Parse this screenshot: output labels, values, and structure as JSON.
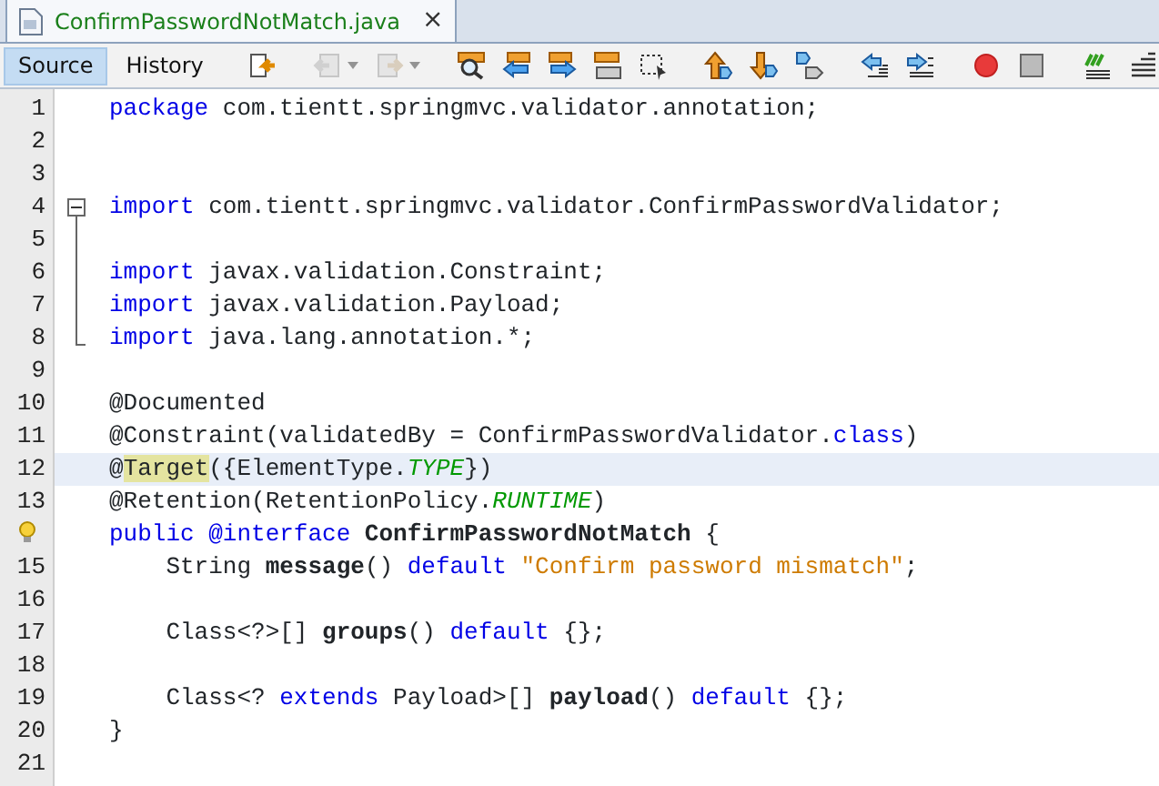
{
  "file_tab": {
    "title": "ConfirmPasswordNotMatch.java",
    "close": "×",
    "selected": true
  },
  "view_tabs": [
    {
      "label": "Source",
      "selected": true
    },
    {
      "label": "History",
      "selected": false
    }
  ],
  "toolbar": [
    {
      "kind": "last-edit",
      "disabled": false
    },
    {
      "kind": "sep"
    },
    {
      "kind": "back",
      "disabled": true,
      "dropdown": true
    },
    {
      "kind": "forward",
      "disabled": true,
      "dropdown": true
    },
    {
      "kind": "sep"
    },
    {
      "kind": "find",
      "disabled": false
    },
    {
      "kind": "find-prev",
      "disabled": false
    },
    {
      "kind": "find-next",
      "disabled": false
    },
    {
      "kind": "highlight",
      "disabled": false
    },
    {
      "kind": "rect-select",
      "disabled": false
    },
    {
      "kind": "sep"
    },
    {
      "kind": "prev-bookmark",
      "disabled": false
    },
    {
      "kind": "next-bookmark",
      "disabled": false
    },
    {
      "kind": "toggle-bookmark",
      "disabled": false
    },
    {
      "kind": "sep"
    },
    {
      "kind": "shift-left",
      "disabled": false
    },
    {
      "kind": "shift-right",
      "disabled": false
    },
    {
      "kind": "sep"
    },
    {
      "kind": "record",
      "disabled": false
    },
    {
      "kind": "stop",
      "disabled": false
    },
    {
      "kind": "sep"
    },
    {
      "kind": "comment",
      "disabled": false
    },
    {
      "kind": "uncomment",
      "disabled": false
    }
  ],
  "lines": [
    {
      "number": "1",
      "selected": false,
      "tokens": [
        {
          "kind": "keyword",
          "text": "package"
        },
        {
          "kind": "plain",
          "text": " com.tientt.springmvc.validator.annotation;"
        }
      ]
    },
    {
      "number": "2",
      "selected": false
    },
    {
      "number": "3",
      "selected": false
    },
    {
      "number": "4",
      "selected": false,
      "expanded": true,
      "tokens": [
        {
          "kind": "keyword",
          "text": "import"
        },
        {
          "kind": "plain",
          "text": " com.tientt.springmvc.validator.ConfirmPasswordValidator;"
        }
      ],
      "children": [
        {
          "number": "5",
          "selected": false
        },
        {
          "number": "6",
          "selected": false,
          "tokens": [
            {
              "kind": "keyword",
              "text": "import"
            },
            {
              "kind": "plain",
              "text": " javax.validation.Constraint;"
            }
          ]
        },
        {
          "number": "7",
          "selected": false,
          "tokens": [
            {
              "kind": "keyword",
              "text": "import"
            },
            {
              "kind": "plain",
              "text": " javax.validation.Payload;"
            }
          ]
        },
        {
          "number": "8",
          "selected": false,
          "tokens": [
            {
              "kind": "keyword",
              "text": "import"
            },
            {
              "kind": "plain",
              "text": " java.lang.annotation.*;"
            }
          ]
        }
      ]
    },
    {
      "number": "9",
      "selected": false
    },
    {
      "number": "10",
      "selected": false,
      "tokens": [
        {
          "kind": "plain",
          "text": "@Documented"
        }
      ]
    },
    {
      "number": "11",
      "selected": false,
      "tokens": [
        {
          "kind": "plain",
          "text": "@Constraint(validatedBy = ConfirmPasswordValidator."
        },
        {
          "kind": "keyword",
          "text": "class"
        },
        {
          "kind": "plain",
          "text": ")"
        }
      ]
    },
    {
      "number": "12",
      "selected": true,
      "tokens": [
        {
          "kind": "plain",
          "text": "@"
        },
        {
          "kind": "marked",
          "text": "Target"
        },
        {
          "kind": "plain",
          "text": "({ElementType."
        },
        {
          "kind": "constant",
          "text": "TYPE"
        },
        {
          "kind": "plain",
          "text": "})"
        }
      ]
    },
    {
      "number": "13",
      "selected": false,
      "tokens": [
        {
          "kind": "plain",
          "text": "@Retention(RetentionPolicy."
        },
        {
          "kind": "constant",
          "text": "RUNTIME"
        },
        {
          "kind": "plain",
          "text": ")"
        }
      ]
    },
    {
      "selected": false,
      "hint": true,
      "tokens": [
        {
          "kind": "keyword",
          "text": "public @interface"
        },
        {
          "kind": "bold",
          "text": " ConfirmPasswordNotMatch"
        },
        {
          "kind": "plain",
          "text": " {"
        }
      ]
    },
    {
      "number": "15",
      "selected": false,
      "tokens": [
        {
          "kind": "plain",
          "text": "    String "
        },
        {
          "kind": "bold",
          "text": "message"
        },
        {
          "kind": "plain",
          "text": "() "
        },
        {
          "kind": "keyword",
          "text": "default"
        },
        {
          "kind": "string",
          "text": " \"Confirm password mismatch\""
        },
        {
          "kind": "plain",
          "text": ";"
        }
      ]
    },
    {
      "number": "16",
      "selected": false
    },
    {
      "number": "17",
      "selected": false,
      "tokens": [
        {
          "kind": "plain",
          "text": "    Class<?>[] "
        },
        {
          "kind": "bold",
          "text": "groups"
        },
        {
          "kind": "plain",
          "text": "() "
        },
        {
          "kind": "keyword",
          "text": "default"
        },
        {
          "kind": "plain",
          "text": " {};"
        }
      ]
    },
    {
      "number": "18",
      "selected": false
    },
    {
      "number": "19",
      "selected": false,
      "tokens": [
        {
          "kind": "plain",
          "text": "    Class<? "
        },
        {
          "kind": "keyword",
          "text": "extends"
        },
        {
          "kind": "plain",
          "text": " Payload>[] "
        },
        {
          "kind": "bold",
          "text": "payload"
        },
        {
          "kind": "plain",
          "text": "() "
        },
        {
          "kind": "keyword",
          "text": "default"
        },
        {
          "kind": "plain",
          "text": " {};"
        }
      ]
    },
    {
      "number": "20",
      "selected": false,
      "tokens": [
        {
          "kind": "plain",
          "text": "}"
        }
      ]
    },
    {
      "number": "21",
      "selected": false
    }
  ]
}
